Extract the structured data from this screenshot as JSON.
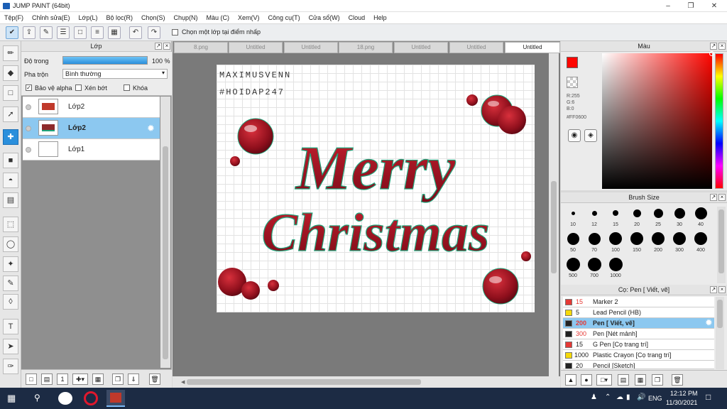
{
  "window": {
    "title": "JUMP PAINT (64bit)"
  },
  "menu": [
    "Tệp(F)",
    "Chỉnh sửa(E)",
    "Lớp(L)",
    "Bộ lọc(R)",
    "Chọn(S)",
    "Chụp(N)",
    "Màu (C)",
    "Xem(V)",
    "Công cụ(T)",
    "Cửa sổ(W)",
    "Cloud",
    "Help"
  ],
  "toolbar": {
    "select_layer_label": "Chọn một lớp tại điểm nhấp"
  },
  "layers": {
    "title": "Lớp",
    "opacity_label": "Độ trong",
    "opacity_value": "100 %",
    "opacity_fraction": 1.0,
    "blend_label": "Pha trộn",
    "blend_value": "Bình thường",
    "protect_alpha": "Bảo vệ alpha",
    "clipping": "Xén bớt",
    "lock": "Khóa",
    "items": [
      {
        "name": "Lớp2",
        "selected": false
      },
      {
        "name": "Lớp2",
        "selected": true
      },
      {
        "name": "Lớp1",
        "selected": false
      }
    ]
  },
  "tabs": [
    "8.png",
    "Untitled",
    "Untitled",
    "18.png",
    "Untitled",
    "Untitled",
    "Untitled"
  ],
  "active_tab_index": 6,
  "artwork": {
    "signature_line1": "MAXIMUSVENN",
    "signature_line2": "#HOIDAP247",
    "word1": "Merry",
    "word2": "Christmas"
  },
  "color": {
    "title": "Màu",
    "r": "R:255",
    "g": "G:6",
    "b": "B:0",
    "hex": "#FF0600",
    "main_color": "#ff0600",
    "accent": "#2a8fdc"
  },
  "brush_size": {
    "title": "Brush Size",
    "sizes": [
      "10",
      "12",
      "15",
      "20",
      "25",
      "30",
      "40",
      "50",
      "70",
      "100",
      "150",
      "200",
      "300",
      "400",
      "500",
      "700",
      "1000"
    ]
  },
  "brush_list": {
    "title": "Cọ: Pen [ Viết, vẽ]",
    "items": [
      {
        "size": "15",
        "name": "Marker 2",
        "color": "#e53935",
        "selected": false
      },
      {
        "size": "5",
        "name": "Lead Pencil (HB)",
        "color": "#f5d90a",
        "selected": false
      },
      {
        "size": "200",
        "name": "Pen [ Viết, vẽ]",
        "color": "#222222",
        "selected": true
      },
      {
        "size": "300",
        "name": "Pen [Nét mảnh]",
        "color": "#222222",
        "selected": false
      },
      {
        "size": "15",
        "name": "G Pen [Cọ trang trí]",
        "color": "#e53935",
        "selected": false
      },
      {
        "size": "1000",
        "name": "Plastic Crayon [Cọ trang trí]",
        "color": "#f5d90a",
        "selected": false
      },
      {
        "size": "20",
        "name": "Pencil [Sketch]",
        "color": "#222222",
        "selected": false
      }
    ]
  },
  "taskbar": {
    "language": "ENG",
    "time": "12:12 PM",
    "date": "11/30/2021"
  }
}
